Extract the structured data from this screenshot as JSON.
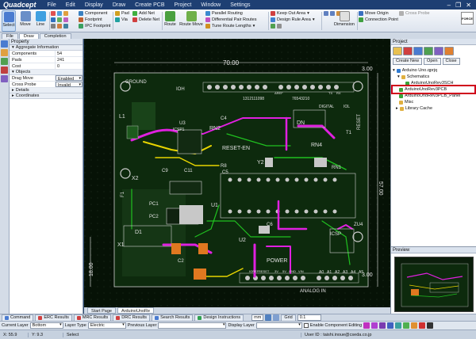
{
  "app": {
    "logo": "Quadcept",
    "menu": [
      "File",
      "Edit",
      "Display",
      "Draw",
      "Create PCB",
      "Project",
      "Window",
      "Settings"
    ],
    "window_buttons": [
      "–",
      "❐",
      "✕"
    ]
  },
  "ribbon": {
    "select": "Select",
    "move": "Move",
    "line": "Line",
    "component": "Component",
    "footprint": "Footprint",
    "ipc_footprint": "IPC Footprint",
    "pad": "Pad",
    "via": "Via",
    "add_net": "Add Net",
    "delete_net": "Delete Net",
    "route": "Route",
    "route_move": "Route Move",
    "parallel_routing": "Parallel Routing",
    "differential_pair": "Differential Pair Routes",
    "tune_route": "Tune Route Lengths",
    "keep_out": "Keep Out Area",
    "design_rule": "Design Rule Area",
    "dimension": "Dimension",
    "move_origin": "Move Origin",
    "connection_point": "Connection Point",
    "cross_probe": "Cross Probe",
    "force": "FORCE"
  },
  "tabs": [
    "File",
    "Draw",
    "Completion"
  ],
  "property": {
    "title": "Property",
    "aggregate": "Aggregate Information",
    "rows": [
      {
        "k": "Components",
        "v": "54"
      },
      {
        "k": "Pads",
        "v": "241"
      },
      {
        "k": "Cost",
        "v": "0"
      }
    ],
    "objects": "Objects",
    "drag_move": {
      "k": "Drag Move",
      "v": "Enabled"
    },
    "cross_probe": {
      "k": "Cross Probe",
      "v": "Invalid"
    },
    "details": "Details",
    "coords": "Coordinates"
  },
  "pcb": {
    "dim_top": "70.00",
    "dim_right_top": "3.00",
    "dim_right": "57.00",
    "dim_left": "18.00",
    "dim_bottom_right": "3.00",
    "labels": {
      "ground": "GROUND",
      "ioh": "IOH",
      "aref": "AREF",
      "digital": "DIGITAL",
      "iol": "IOL",
      "pins_top": "1312111098",
      "pins_top2": "76543210",
      "l1": "L1",
      "rn2": "RN2",
      "c4": "C4",
      "reset_en": "RESET-EN",
      "dn": "DN",
      "rn4": "RN4",
      "rn1": "RN1",
      "reset": "RESET",
      "y2": "Y2",
      "x2": "X2",
      "x1": "X1",
      "f1": "F1",
      "c9": "C9",
      "c11": "C11",
      "u1": "U1",
      "u2": "U2",
      "u3": "U3",
      "d1": "D1",
      "c6": "C6",
      "zu4": "ZU4",
      "icsp": "ICSP",
      "power": "POWER",
      "analog_in": "ANALOG IN",
      "c2": "C2",
      "pc1": "PC1",
      "pc2": "PC2",
      "t1": "T1",
      "r8": "R8",
      "c5": "C5",
      "icsp1": "ICSP1",
      "a0": "A0",
      "a1": "A1",
      "a2": "A2",
      "a3": "A3",
      "a4": "A4",
      "a5": "A5",
      "ioref": "IOREF",
      "reset2": "RESET",
      "v3": "3V",
      "v5": "5V",
      "gnd": "GND",
      "vin": "VIN",
      "rx": "RX",
      "tx": "TX"
    }
  },
  "canvas_tabs": [
    "Start Page",
    "ArduinoUnoRe"
  ],
  "project": {
    "title": "Project",
    "buttons": [
      "Create New",
      "Open",
      "Close"
    ],
    "tree": [
      {
        "label": "Arduino Uno.qprjq",
        "level": 0,
        "color": "#2f7bd3"
      },
      {
        "label": "Schematics",
        "level": 1,
        "color": "#e0b040"
      },
      {
        "label": "ArduinoUnoRev3SCH",
        "level": 2,
        "color": "#3aa43a"
      },
      {
        "label": "ArduinoUnoRev3PCB",
        "level": 1,
        "color": "#3aa43a",
        "highlight": true
      },
      {
        "label": "ArduinoUnoRev3PCB_Panel",
        "level": 1,
        "color": "#3aa43a"
      },
      {
        "label": "Misc",
        "level": 1,
        "color": "#e0b040"
      },
      {
        "label": "Library Cache",
        "level": 1,
        "color": "#e0b040"
      }
    ]
  },
  "preview": {
    "title": "Preview"
  },
  "messages": {
    "tabs": [
      "Command",
      "ERC Results",
      "MRC Results",
      "DRC Results",
      "Search Results",
      "Design Instructions"
    ],
    "tab_colors": [
      "#4a7bd0",
      "#d04040",
      "#d04040",
      "#d04040",
      "#4a7bd0",
      "#30a050"
    ],
    "unit": "mm",
    "grid_label": "Grid",
    "grid_value": "0.1"
  },
  "layerbar": {
    "current_layer_label": "Current Layer",
    "current_layer": "Bottom",
    "layer_type_label": "Layer Type",
    "layer_type": "Electric",
    "previous_layer_label": "Previous Layer",
    "display_layer_label": "Display Layer",
    "enable_component_editing": "Enable Component Editing",
    "colors": [
      "#c030c0",
      "#b040d0",
      "#7a3ab0",
      "#4060c0",
      "#3aa0a0",
      "#50b050",
      "#e09030",
      "#d03030",
      "#333333"
    ]
  },
  "status": {
    "x": "X: 55.9",
    "y": "Y: 9.3",
    "mode": "Select",
    "user": "User ID : taishi.inoue@cseda.co.jp"
  }
}
